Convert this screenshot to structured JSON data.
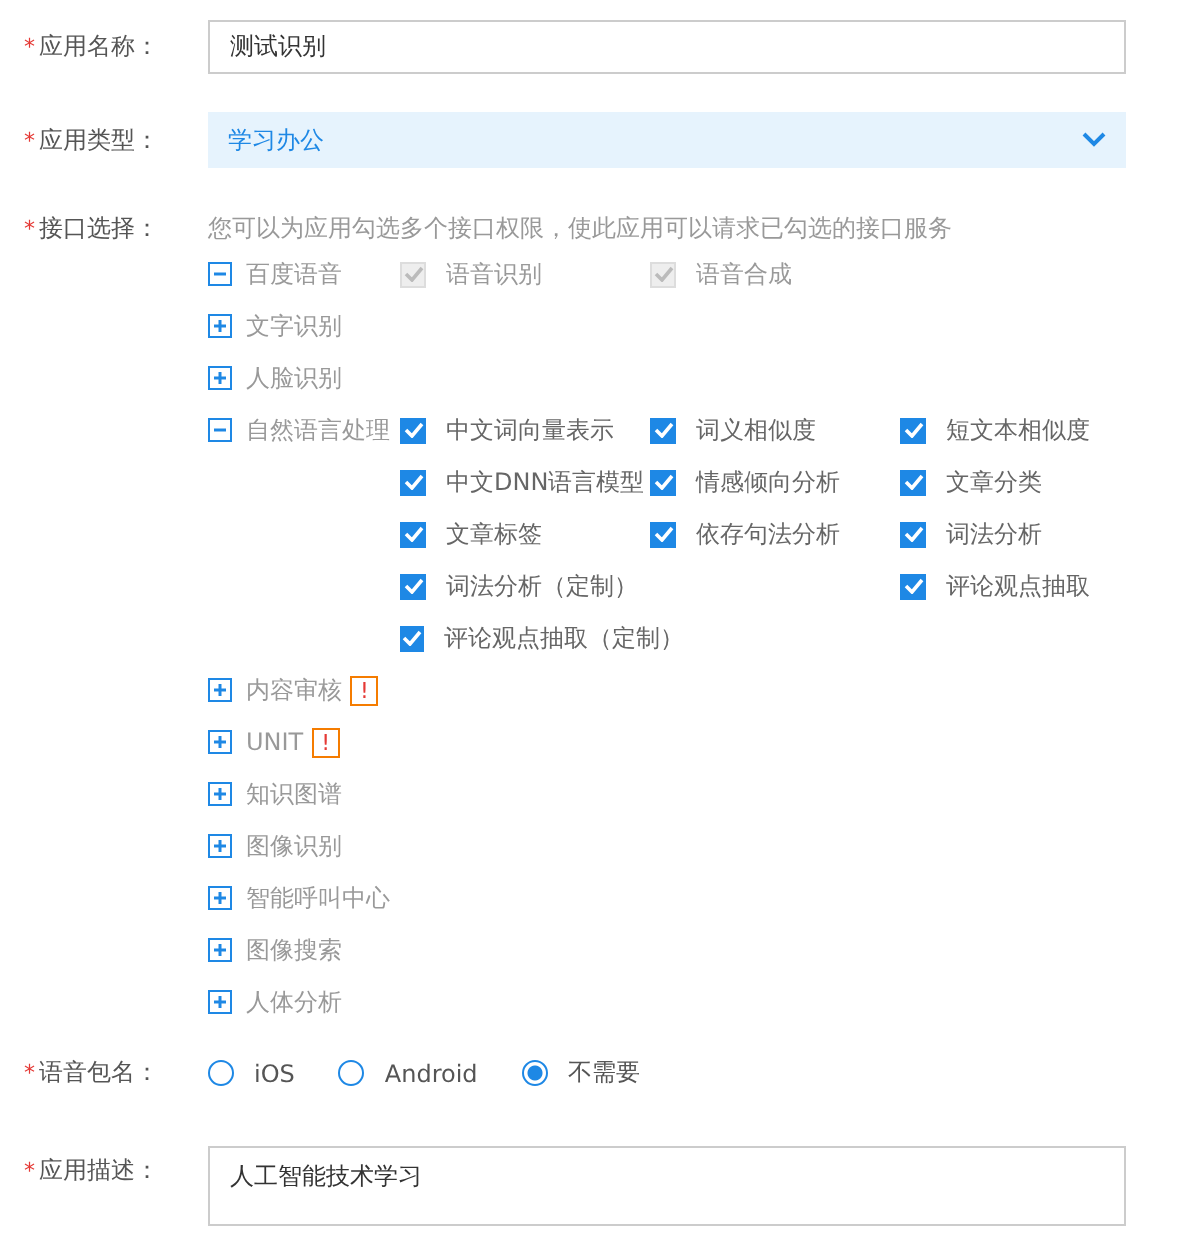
{
  "app_name": {
    "label": "应用名称：",
    "required_mark": "*",
    "value": "测试识别"
  },
  "app_type": {
    "label": "应用类型：",
    "required_mark": "*",
    "value": "学习办公"
  },
  "interfaces": {
    "label": "接口选择：",
    "required_mark": "*",
    "hint": "您可以为应用勾选多个接口权限，使此应用可以请求已勾选的接口服务",
    "groups": [
      {
        "label": "百度语音",
        "expanded": true,
        "columns": [
          [
            {
              "label": "语音识别",
              "checked": true,
              "disabled": true
            }
          ],
          [
            {
              "label": "语音合成",
              "checked": true,
              "disabled": true
            }
          ]
        ]
      },
      {
        "label": "文字识别",
        "expanded": false
      },
      {
        "label": "人脸识别",
        "expanded": false
      },
      {
        "label": "自然语言处理",
        "expanded": true,
        "columns": [
          [
            {
              "label": "中文词向量表示",
              "checked": true,
              "disabled": false
            },
            {
              "label": "中文DNN语言模型",
              "checked": true,
              "disabled": false
            },
            {
              "label": "文章标签",
              "checked": true,
              "disabled": false
            },
            {
              "label": "词法分析（定制）",
              "checked": true,
              "disabled": false
            },
            {
              "label": "评论观点抽取（定制）",
              "checked": true,
              "disabled": false
            }
          ],
          [
            {
              "label": "词义相似度",
              "checked": true,
              "disabled": false
            },
            {
              "label": "情感倾向分析",
              "checked": true,
              "disabled": false
            },
            {
              "label": "依存句法分析",
              "checked": true,
              "disabled": false
            }
          ],
          [
            {
              "label": "短文本相似度",
              "checked": true,
              "disabled": false
            },
            {
              "label": "文章分类",
              "checked": true,
              "disabled": false
            },
            {
              "label": "词法分析",
              "checked": true,
              "disabled": false
            },
            {
              "label": "评论观点抽取",
              "checked": true,
              "disabled": false
            }
          ]
        ]
      },
      {
        "label": "内容审核",
        "expanded": false,
        "badge": "!"
      },
      {
        "label": "UNIT",
        "expanded": false,
        "badge": "!"
      },
      {
        "label": "知识图谱",
        "expanded": false
      },
      {
        "label": "图像识别",
        "expanded": false
      },
      {
        "label": "智能呼叫中心",
        "expanded": false
      },
      {
        "label": "图像搜索",
        "expanded": false
      },
      {
        "label": "人体分析",
        "expanded": false
      }
    ]
  },
  "package": {
    "label": "语音包名：",
    "required_mark": "*",
    "options": [
      {
        "label": "iOS",
        "selected": false
      },
      {
        "label": "Android",
        "selected": false
      },
      {
        "label": "不需要",
        "selected": true
      }
    ]
  },
  "description": {
    "label": "应用描述：",
    "required_mark": "*",
    "value": "人工智能技术学习"
  }
}
